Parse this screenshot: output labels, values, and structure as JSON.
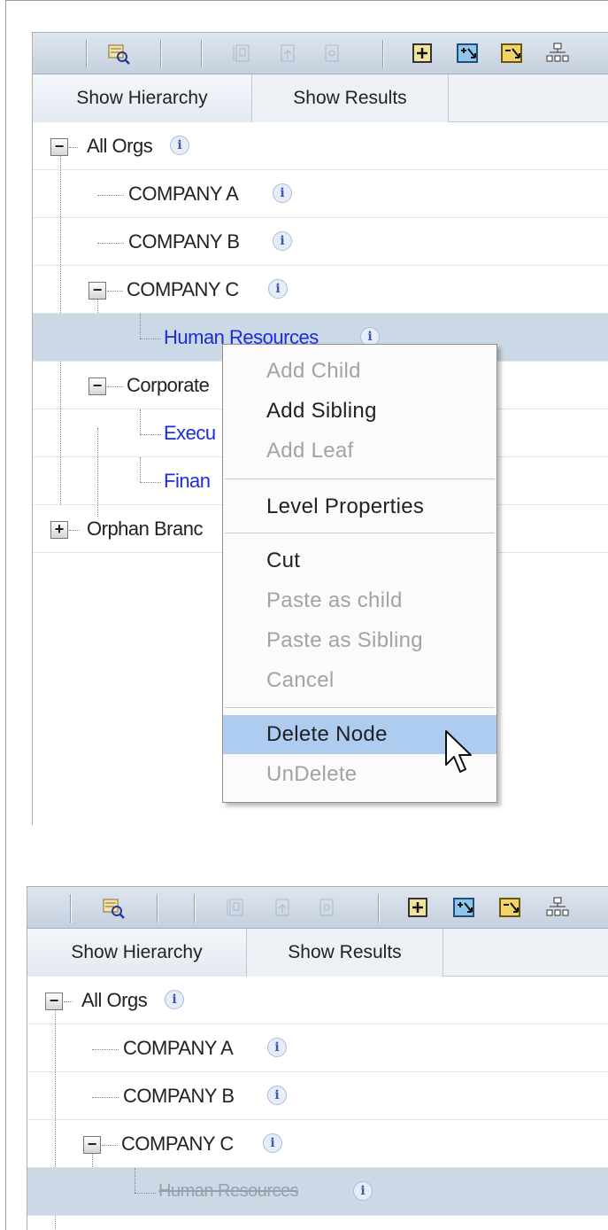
{
  "panel_before": {
    "tabs": {
      "hierarchy": "Show Hierarchy",
      "results": "Show Results"
    },
    "tree": [
      {
        "label": "All Orgs",
        "expander": "−"
      },
      {
        "label": "COMPANY A"
      },
      {
        "label": "COMPANY B"
      },
      {
        "label": "COMPANY C",
        "expander": "−"
      },
      {
        "label": "Human Resources",
        "state": "selected"
      },
      {
        "label": "Corporate",
        "expander": "−"
      },
      {
        "label": "Execu"
      },
      {
        "label": "Finan"
      },
      {
        "label": "Orphan Branc",
        "expander": "+"
      }
    ],
    "info_glyph": "i"
  },
  "context_menu": {
    "items": [
      {
        "label": "Add Child",
        "enabled": false
      },
      {
        "label": "Add Sibling",
        "enabled": true
      },
      {
        "label": "Add Leaf",
        "enabled": false
      },
      {
        "label": "Level Properties",
        "enabled": true
      },
      {
        "label": "Cut",
        "enabled": true
      },
      {
        "label": "Paste as child",
        "enabled": false
      },
      {
        "label": "Paste as Sibling",
        "enabled": false
      },
      {
        "label": "Cancel",
        "enabled": false
      },
      {
        "label": "Delete Node",
        "enabled": true,
        "highlighted": true
      },
      {
        "label": "UnDelete",
        "enabled": false
      }
    ]
  },
  "panel_after": {
    "tabs": {
      "hierarchy": "Show Hierarchy",
      "results": "Show Results"
    },
    "tree": [
      {
        "label": "All Orgs",
        "expander": "−"
      },
      {
        "label": "COMPANY A"
      },
      {
        "label": "COMPANY B"
      },
      {
        "label": "COMPANY C",
        "expander": "−"
      },
      {
        "label": "Human Resources",
        "state": "deleted"
      }
    ],
    "info_glyph": "i"
  },
  "colors": {
    "selection": "#cbd8e6",
    "menu_highlight": "#aecbf0",
    "link_blue": "#1c2bdc",
    "disabled_text": "#a3a3a3"
  },
  "icons": [
    "find-icon",
    "copy-node-icon",
    "move-node-icon",
    "replace-node-icon",
    "add-child-icon",
    "expand-all-icon",
    "collapse-all-icon",
    "org-chart-icon",
    "info-icon",
    "mouse-pointer-icon"
  ]
}
